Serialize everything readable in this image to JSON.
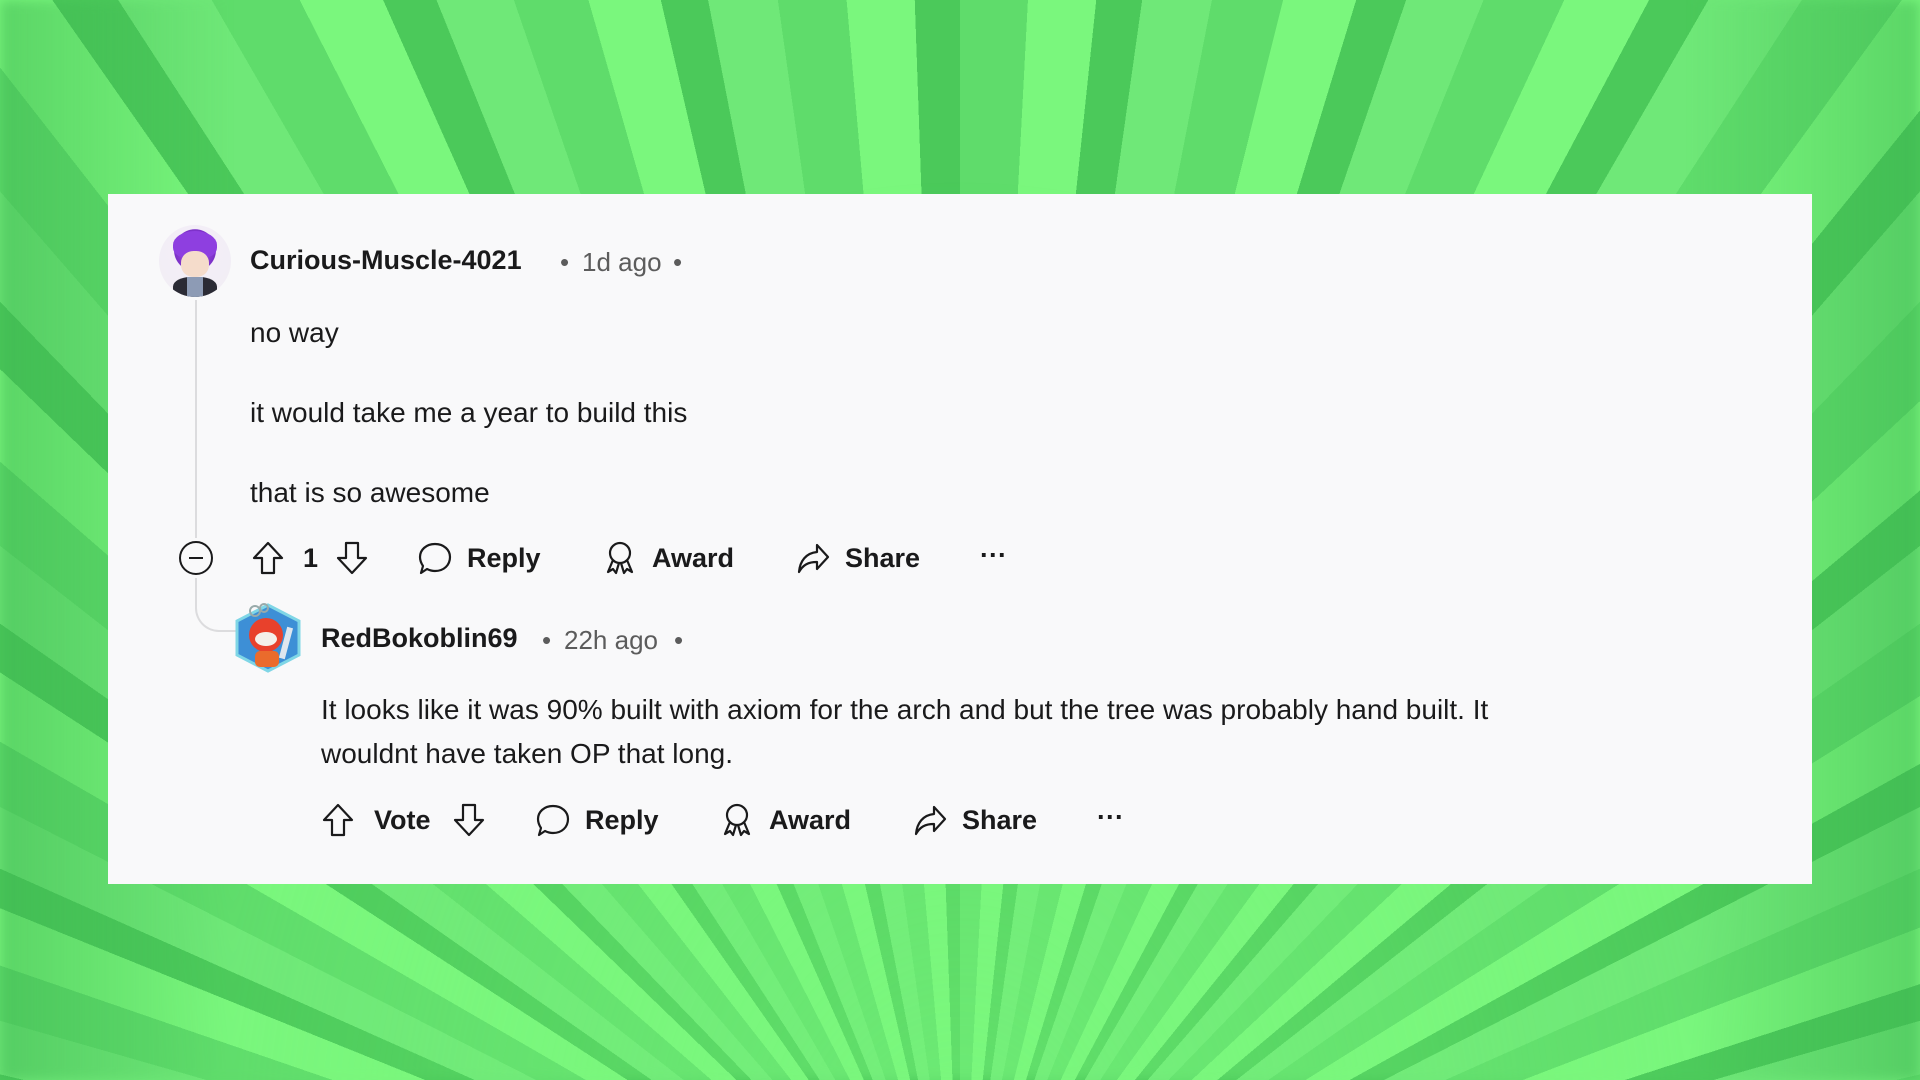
{
  "background": {
    "colors": [
      "#5fdc6b",
      "#7af77d",
      "#4bc95a"
    ]
  },
  "comment": {
    "author": "Curious-Muscle-4021",
    "separator": "•",
    "time": "1d ago",
    "body": [
      "no way",
      "it would take me a year to build this",
      "that is so awesome"
    ],
    "votes": "1",
    "actions": {
      "reply": "Reply",
      "award": "Award",
      "share": "Share",
      "more": "···"
    }
  },
  "reply": {
    "author": "RedBokoblin69",
    "separator": "•",
    "time": "22h ago",
    "body": [
      "It looks like it was 90% built with axiom for the arch and but the tree was probably hand built. It",
      "wouldnt have taken OP that long."
    ],
    "votes": "Vote",
    "actions": {
      "reply": "Reply",
      "award": "Award",
      "share": "Share",
      "more": "···"
    }
  }
}
